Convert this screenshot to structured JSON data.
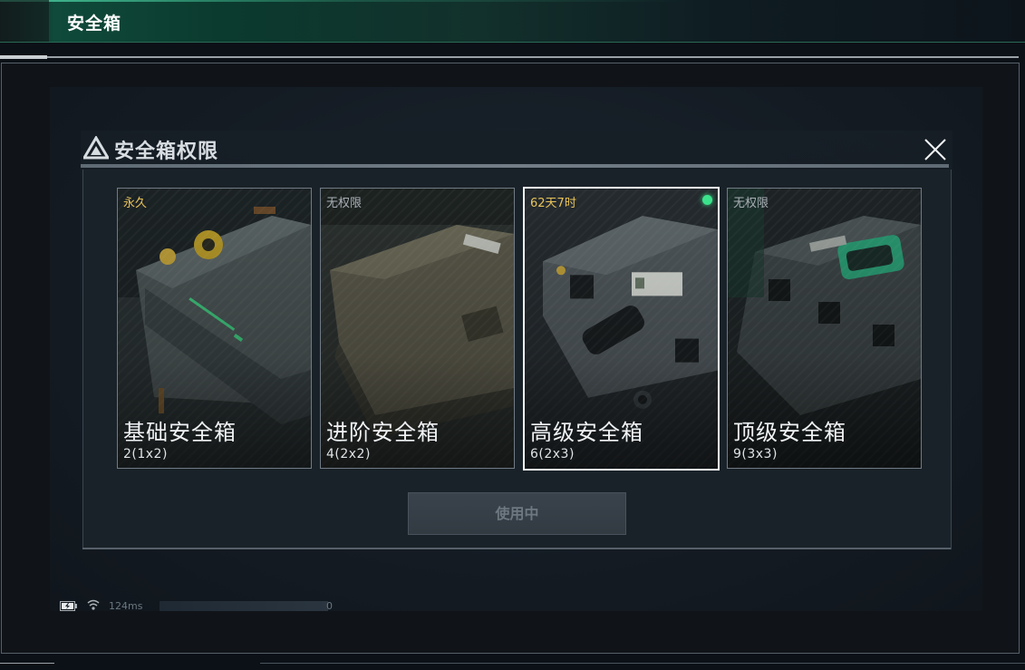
{
  "header": {
    "title": "安全箱"
  },
  "dialog": {
    "title": "安全箱权限",
    "close_icon": "close-icon",
    "action_button": "使用中"
  },
  "cards": [
    {
      "duration": "永久",
      "name": "基础安全箱",
      "capacity": "2(1x2)",
      "selected": false,
      "active": false
    },
    {
      "duration": "无权限",
      "name": "进阶安全箱",
      "capacity": "4(2x2)",
      "selected": false,
      "active": false
    },
    {
      "duration": "62天7时",
      "name": "高级安全箱",
      "capacity": "6(2x3)",
      "selected": true,
      "active": true
    },
    {
      "duration": "无权限",
      "name": "顶级安全箱",
      "capacity": "9(3x3)",
      "selected": false,
      "active": false
    }
  ],
  "status": {
    "ping": "124ms",
    "load_value": "0",
    "battery_icon": "battery-charging-icon",
    "wifi_icon": "wifi-icon"
  },
  "colors": {
    "accent_green": "#3be38c",
    "duration_gold": "#e7c35a",
    "topbar_green": "#0f4a3a"
  }
}
